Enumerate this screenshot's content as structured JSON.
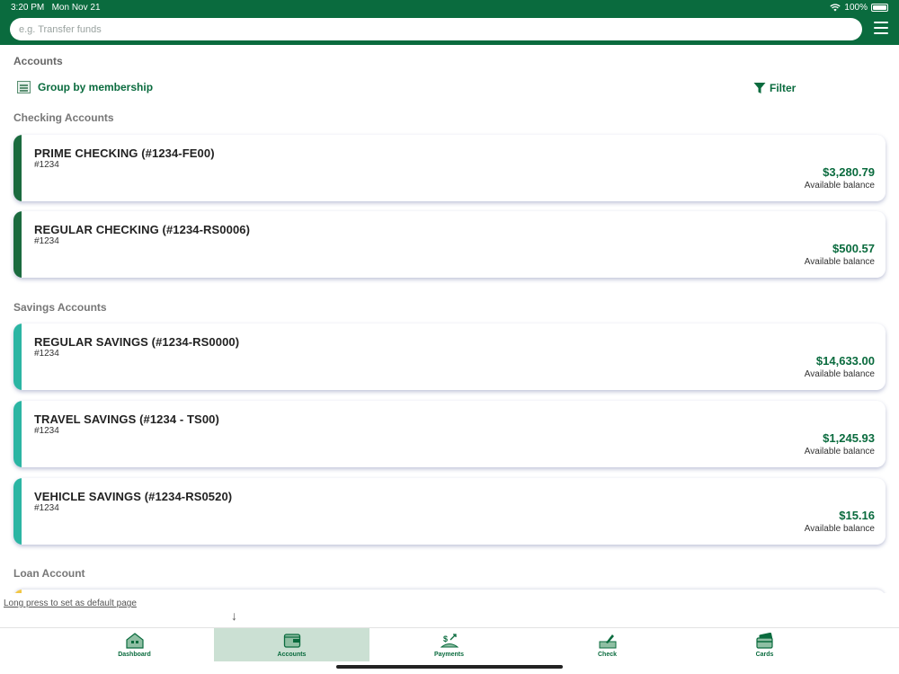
{
  "status_bar": {
    "time": "3:20 PM",
    "date": "Mon Nov 21",
    "battery": "100%"
  },
  "search": {
    "placeholder": "e.g. Transfer funds",
    "value": ""
  },
  "page_title": "Accounts",
  "toolbar": {
    "group_label": "Group by membership",
    "filter_label": "Filter"
  },
  "sections": {
    "checking": {
      "title": "Checking Accounts",
      "accounts": [
        {
          "name": "PRIME CHECKING (#1234-FE00)",
          "number": "#1234",
          "balance": "$3,280.79",
          "balance_label": "Available balance"
        },
        {
          "name": "REGULAR CHECKING (#1234-RS0006)",
          "number": "#1234",
          "balance": "$500.57",
          "balance_label": "Available balance"
        }
      ]
    },
    "savings": {
      "title": "Savings Accounts",
      "accounts": [
        {
          "name": "REGULAR SAVINGS (#1234-RS0000)",
          "number": "#1234",
          "balance": "$14,633.00",
          "balance_label": "Available balance"
        },
        {
          "name": "TRAVEL SAVINGS (#1234 - TS00)",
          "number": "#1234",
          "balance": "$1,245.93",
          "balance_label": "Available balance"
        },
        {
          "name": "VEHICLE SAVINGS (#1234-RS0520)",
          "number": "#1234",
          "balance": "$15.16",
          "balance_label": "Available balance"
        }
      ]
    },
    "loan": {
      "title": "Loan Account"
    }
  },
  "hint": "Long press to set as default page",
  "tabs": [
    {
      "label": "Dashboard",
      "icon": "home-icon"
    },
    {
      "label": "Accounts",
      "icon": "wallet-icon",
      "active": true
    },
    {
      "label": "Payments",
      "icon": "payments-icon"
    },
    {
      "label": "Check",
      "icon": "check-deposit-icon"
    },
    {
      "label": "Cards",
      "icon": "cards-icon"
    }
  ],
  "colors": {
    "brand": "#0a6b3e",
    "checking_stripe": "#1b6b3f",
    "savings_stripe": "#2bb5a3",
    "loan_stripe": "#f2c744",
    "active_tab": "#cbe0d3"
  }
}
